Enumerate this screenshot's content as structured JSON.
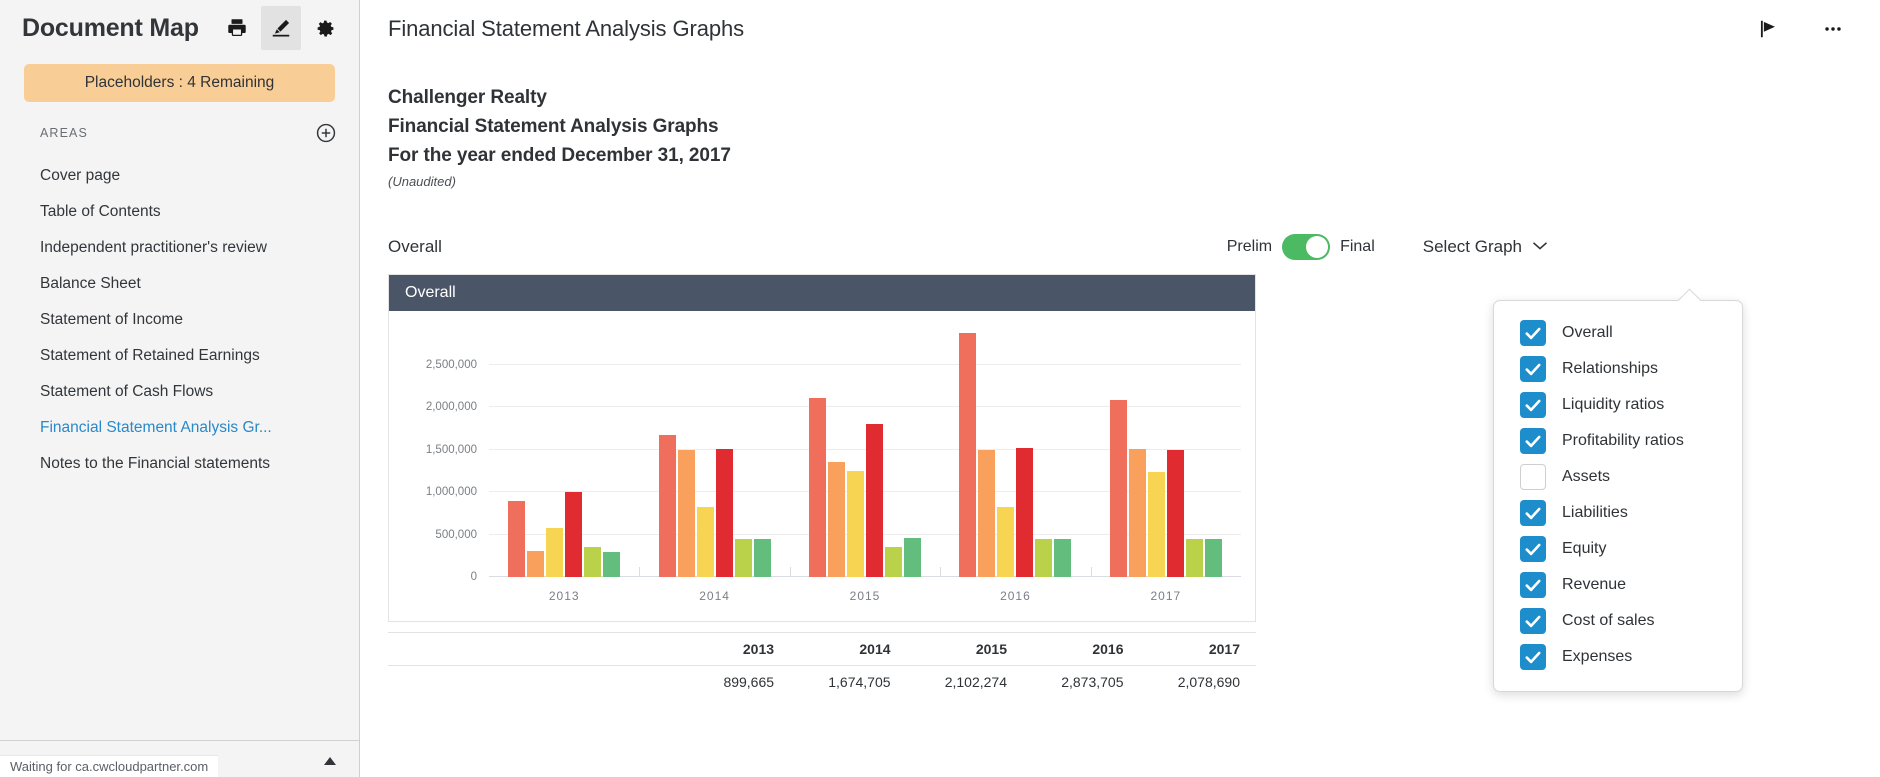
{
  "sidebar": {
    "title": "Document Map",
    "icons": [
      {
        "name": "print-icon",
        "label": "Print"
      },
      {
        "name": "pen-edit-icon",
        "label": "Edit"
      },
      {
        "name": "gear-icon",
        "label": "Settings"
      }
    ],
    "placeholders_badge": "Placeholders : 4 Remaining",
    "areas_label": "AREAS",
    "add_area_label": "Add area",
    "items": [
      {
        "label": "Cover page",
        "selected": false
      },
      {
        "label": "Table of Contents",
        "selected": false
      },
      {
        "label": "Independent practitioner's review",
        "selected": false
      },
      {
        "label": "Balance Sheet",
        "selected": false
      },
      {
        "label": "Statement of Income",
        "selected": false
      },
      {
        "label": "Statement of Retained Earnings",
        "selected": false
      },
      {
        "label": "Statement of Cash Flows",
        "selected": false
      },
      {
        "label": "Financial Statement Analysis Gr...",
        "selected": true
      },
      {
        "label": "Notes to the Financial statements",
        "selected": false
      }
    ]
  },
  "header": {
    "doc_title": "Financial Statement Analysis Graphs",
    "flag_icon": "flag-icon",
    "more_icon": "ellipsis-icon"
  },
  "document": {
    "company": "Challenger Realty",
    "report_title": "Financial Statement Analysis Graphs",
    "period": "For the year ended December 31, 2017",
    "unaudited": "(Unaudited)"
  },
  "controls": {
    "graph_label": "Overall",
    "toggle_left": "Prelim",
    "toggle_right": "Final",
    "toggle_on": true,
    "toggle_color": "#4cb963",
    "select_graph_label": "Select Graph",
    "chevron_icon": "chevron-down-icon"
  },
  "chart_card": {
    "header": "Overall"
  },
  "dropdown": {
    "items": [
      {
        "label": "Overall",
        "checked": true
      },
      {
        "label": "Relationships",
        "checked": true
      },
      {
        "label": "Liquidity ratios",
        "checked": true
      },
      {
        "label": "Profitability ratios",
        "checked": true
      },
      {
        "label": "Assets",
        "checked": false
      },
      {
        "label": "Liabilities",
        "checked": true
      },
      {
        "label": "Equity",
        "checked": true
      },
      {
        "label": "Revenue",
        "checked": true
      },
      {
        "label": "Cost of sales",
        "checked": true
      },
      {
        "label": "Expenses",
        "checked": true
      }
    ],
    "checked_color": "#1d8dcb"
  },
  "chart_data": {
    "type": "bar",
    "title": "Overall",
    "xlabel": "",
    "ylabel": "",
    "categories": [
      "2013",
      "2014",
      "2015",
      "2016",
      "2017"
    ],
    "ytick_labels": [
      "0",
      "500,000",
      "1,000,000",
      "1,500,000",
      "2,000,000",
      "2,500,000"
    ],
    "ytick_values": [
      0,
      500000,
      1000000,
      1500000,
      2000000,
      2500000
    ],
    "ylim": [
      0,
      2800000
    ],
    "grid": true,
    "legend": "none",
    "series": [
      {
        "name": "Assets",
        "color": "#ef6f5c",
        "values": [
          899665,
          1674705,
          2102274,
          2873705,
          2078690
        ]
      },
      {
        "name": "Liabilities",
        "color": "#f9a15c",
        "values": [
          310000,
          1500000,
          1355000,
          1500000,
          1510000
        ]
      },
      {
        "name": "Equity",
        "color": "#f7d451",
        "values": [
          580000,
          820000,
          1252000,
          820000,
          1240000
        ]
      },
      {
        "name": "Revenue",
        "color": "#e02b31",
        "values": [
          1005000,
          1510000,
          1800000,
          1512000,
          1495000
        ]
      },
      {
        "name": "Cost of sales",
        "color": "#b9d24a",
        "values": [
          350000,
          450000,
          355000,
          450000,
          450000
        ]
      },
      {
        "name": "Expenses",
        "color": "#63bd7c",
        "values": [
          290000,
          445000,
          460000,
          445000,
          445000
        ]
      }
    ]
  },
  "table": {
    "columns": [
      "",
      "2013",
      "2014",
      "2015",
      "2016",
      "2017"
    ],
    "rows": [
      {
        "label": "",
        "values": [
          "899,665",
          "1,674,705",
          "2,102,274",
          "2,873,705",
          "2,078,690"
        ]
      }
    ]
  },
  "statusbar": {
    "text": "Waiting for ca.cwcloudpartner.com"
  }
}
